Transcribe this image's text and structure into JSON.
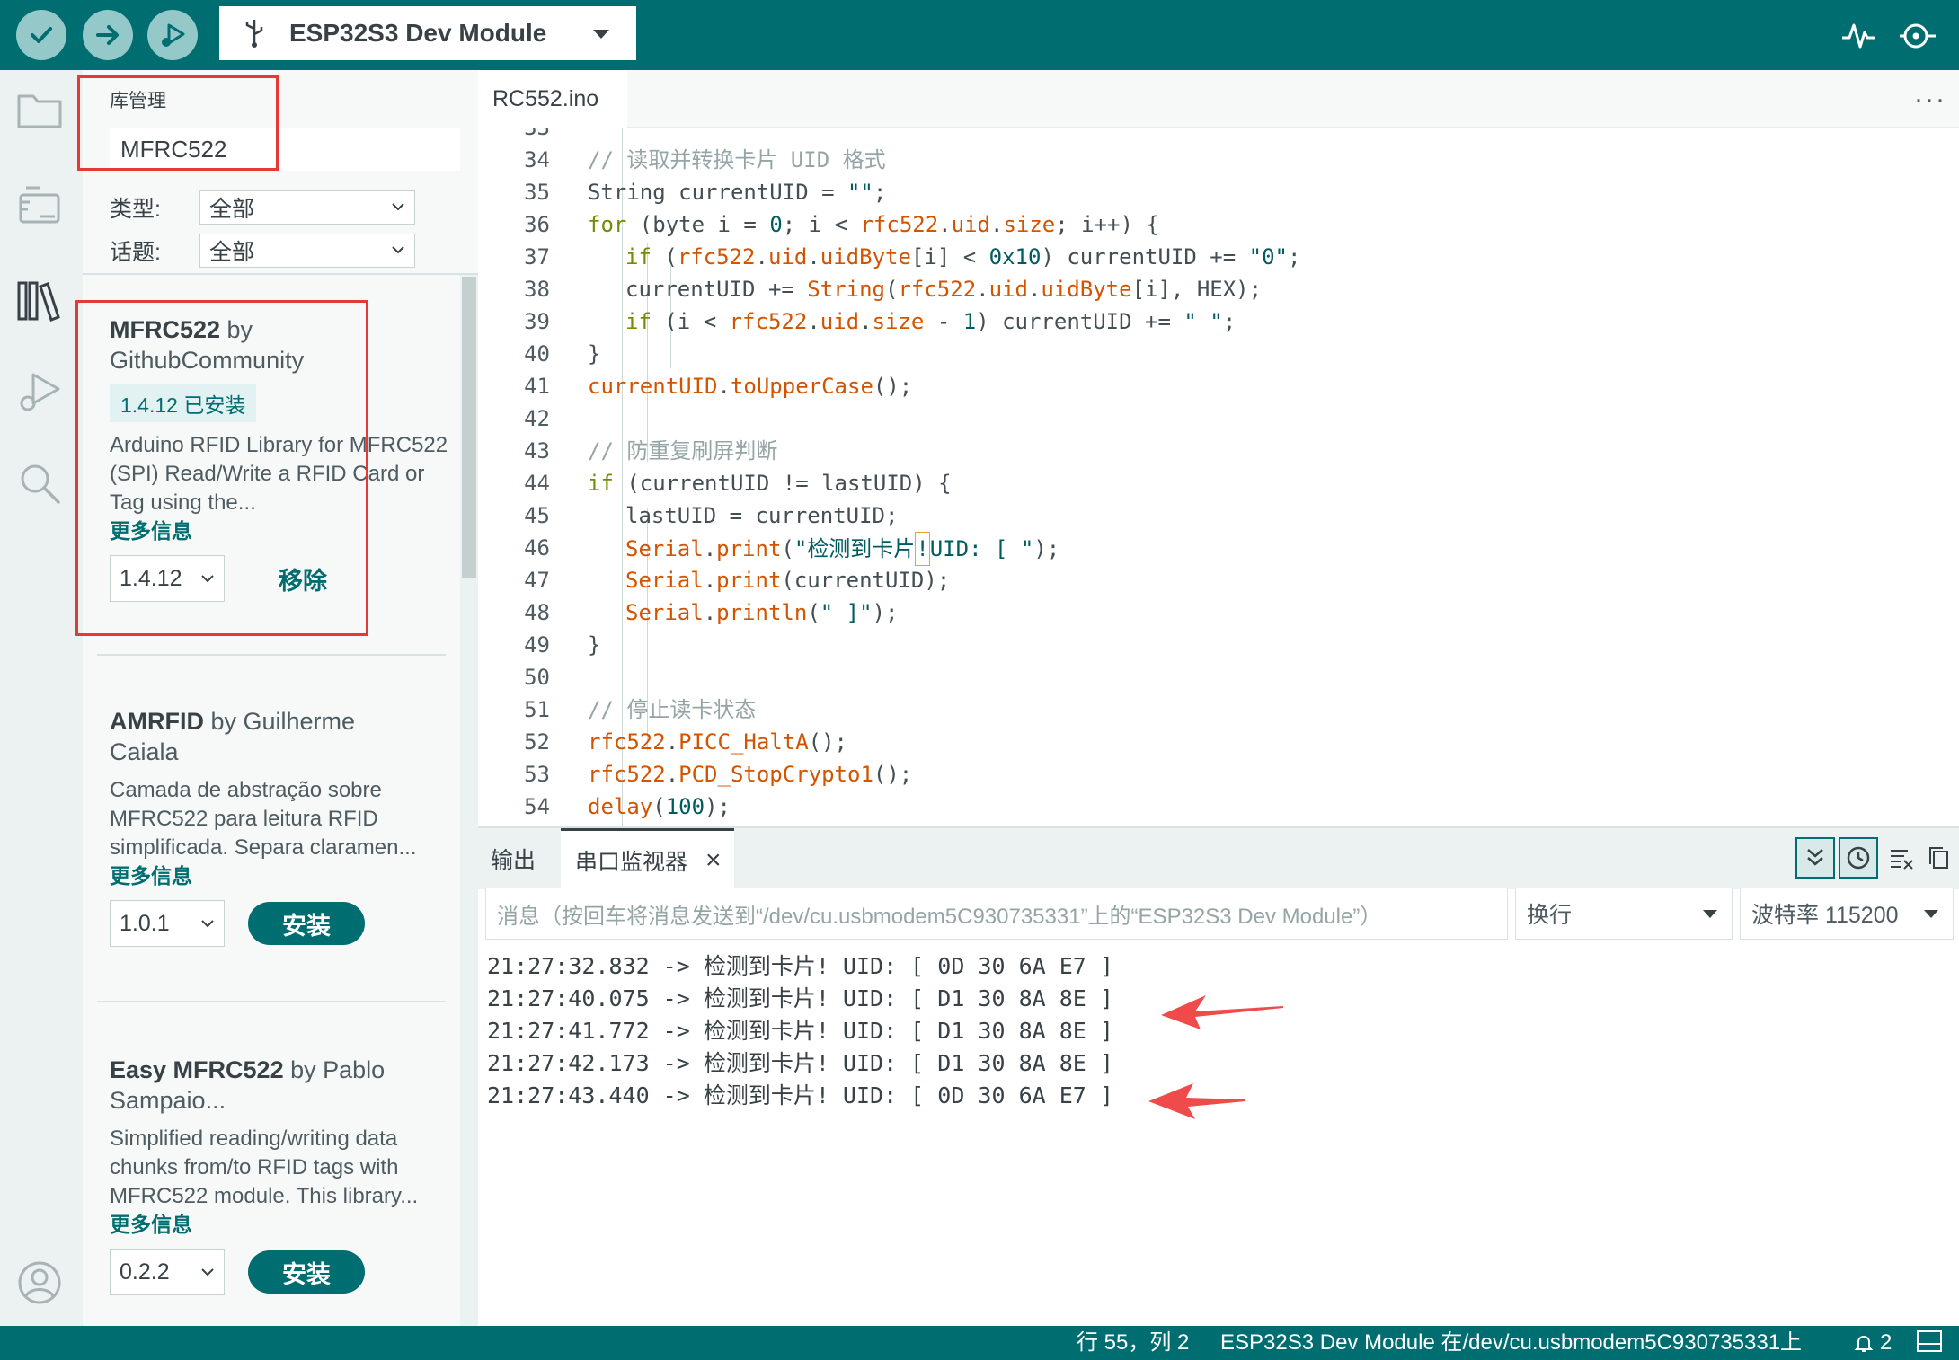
{
  "toolbar": {
    "verify_icon": "check-icon",
    "upload_icon": "arrow-right-icon",
    "debug_icon": "debug-icon",
    "board_name": "ESP32S3 Dev Module",
    "serial_plotter_icon": "pulse-icon",
    "serial_monitor_icon": "magnifier-icon"
  },
  "sidebar": {
    "icons": [
      "folder-icon",
      "board-icon",
      "library-icon",
      "debug-icon",
      "search-icon",
      "account-icon"
    ]
  },
  "library_manager": {
    "title": "库管理",
    "search_value": "MFRC522",
    "type_label": "类型:",
    "type_value": "全部",
    "topic_label": "话题:",
    "topic_value": "全部",
    "items": [
      {
        "name": "MFRC522",
        "by": " by",
        "author": "GithubCommunity",
        "installed_badge": "1.4.12 已安装",
        "desc": "Arduino RFID Library for MFRC522 (SPI) Read/Write a RFID Card or Tag using the...",
        "more": "更多信息",
        "version": "1.4.12",
        "action": "移除"
      },
      {
        "name": "AMRFID",
        "by": " by Guilherme",
        "author": "Caiala",
        "desc": "Camada de abstração sobre MFRC522 para leitura RFID simplificada. Separa claramen...",
        "more": "更多信息",
        "version": "1.0.1",
        "action": "安装"
      },
      {
        "name": "Easy MFRC522",
        "by": " by Pablo",
        "author": "Sampaio...",
        "desc": "Simplified reading/writing data chunks from/to RFID tags with MFRC522 module. This library...",
        "more": "更多信息",
        "version": "0.2.2",
        "action": "安装"
      }
    ]
  },
  "editor": {
    "file_tab": "RC552.ino",
    "more": "···",
    "lines": [
      {
        "n": "33",
        "indent": 0,
        "tokens": []
      },
      {
        "n": "34",
        "indent": 1,
        "tokens": [
          [
            "com",
            "// 读取并转换卡片 UID 格式"
          ]
        ]
      },
      {
        "n": "35",
        "indent": 1,
        "tokens": [
          [
            "def",
            "String currentUID = "
          ],
          [
            "str",
            "\"\""
          ],
          [
            "def",
            ";"
          ]
        ]
      },
      {
        "n": "36",
        "indent": 1,
        "tokens": [
          [
            "kw",
            "for"
          ],
          [
            "def",
            " (byte i = "
          ],
          [
            "num",
            "0"
          ],
          [
            "def",
            "; i < "
          ],
          [
            "fn",
            "rfc522"
          ],
          [
            "def",
            "."
          ],
          [
            "fn",
            "uid"
          ],
          [
            "def",
            "."
          ],
          [
            "fn",
            "size"
          ],
          [
            "def",
            "; i++) {"
          ]
        ]
      },
      {
        "n": "37",
        "indent": 2,
        "tokens": [
          [
            "kw",
            "if"
          ],
          [
            "def",
            " ("
          ],
          [
            "fn",
            "rfc522"
          ],
          [
            "def",
            "."
          ],
          [
            "fn",
            "uid"
          ],
          [
            "def",
            "."
          ],
          [
            "fn",
            "uidByte"
          ],
          [
            "def",
            "[i] < "
          ],
          [
            "num",
            "0x10"
          ],
          [
            "def",
            ") currentUID += "
          ],
          [
            "str",
            "\"0\""
          ],
          [
            "def",
            ";"
          ]
        ]
      },
      {
        "n": "38",
        "indent": 2,
        "tokens": [
          [
            "def",
            "currentUID += "
          ],
          [
            "fn",
            "String"
          ],
          [
            "def",
            "("
          ],
          [
            "fn",
            "rfc522"
          ],
          [
            "def",
            "."
          ],
          [
            "fn",
            "uid"
          ],
          [
            "def",
            "."
          ],
          [
            "fn",
            "uidByte"
          ],
          [
            "def",
            "[i], HEX);"
          ]
        ]
      },
      {
        "n": "39",
        "indent": 2,
        "tokens": [
          [
            "kw",
            "if"
          ],
          [
            "def",
            " (i < "
          ],
          [
            "fn",
            "rfc522"
          ],
          [
            "def",
            "."
          ],
          [
            "fn",
            "uid"
          ],
          [
            "def",
            "."
          ],
          [
            "fn",
            "size"
          ],
          [
            "def",
            " - "
          ],
          [
            "num",
            "1"
          ],
          [
            "def",
            ") currentUID += "
          ],
          [
            "str",
            "\" \""
          ],
          [
            "def",
            ";"
          ]
        ]
      },
      {
        "n": "40",
        "indent": 1,
        "tokens": [
          [
            "def",
            "}"
          ]
        ]
      },
      {
        "n": "41",
        "indent": 1,
        "tokens": [
          [
            "fn",
            "currentUID"
          ],
          [
            "def",
            "."
          ],
          [
            "fn",
            "toUpperCase"
          ],
          [
            "def",
            "();"
          ]
        ]
      },
      {
        "n": "42",
        "indent": 1,
        "tokens": []
      },
      {
        "n": "43",
        "indent": 1,
        "tokens": [
          [
            "com",
            "// 防重复刷屏判断"
          ]
        ]
      },
      {
        "n": "44",
        "indent": 1,
        "tokens": [
          [
            "kw",
            "if"
          ],
          [
            "def",
            " (currentUID != lastUID) {"
          ]
        ]
      },
      {
        "n": "45",
        "indent": 2,
        "tokens": [
          [
            "def",
            "lastUID = currentUID;"
          ]
        ]
      },
      {
        "n": "46",
        "indent": 2,
        "tokens": [
          [
            "fn",
            "Serial"
          ],
          [
            "def",
            "."
          ],
          [
            "fn",
            "print"
          ],
          [
            "def",
            "("
          ],
          [
            "str",
            "\"检测到卡片"
          ],
          [
            "cur",
            "!"
          ],
          [
            "str",
            "UID: [ \""
          ],
          [
            "def",
            ");"
          ]
        ]
      },
      {
        "n": "47",
        "indent": 2,
        "tokens": [
          [
            "fn",
            "Serial"
          ],
          [
            "def",
            "."
          ],
          [
            "fn",
            "print"
          ],
          [
            "def",
            "(currentUID);"
          ]
        ]
      },
      {
        "n": "48",
        "indent": 2,
        "tokens": [
          [
            "fn",
            "Serial"
          ],
          [
            "def",
            "."
          ],
          [
            "fn",
            "println"
          ],
          [
            "def",
            "("
          ],
          [
            "str",
            "\" ]\""
          ],
          [
            "def",
            ");"
          ]
        ]
      },
      {
        "n": "49",
        "indent": 1,
        "tokens": [
          [
            "def",
            "}"
          ]
        ]
      },
      {
        "n": "50",
        "indent": 1,
        "tokens": []
      },
      {
        "n": "51",
        "indent": 1,
        "tokens": [
          [
            "com",
            "// 停止读卡状态"
          ]
        ]
      },
      {
        "n": "52",
        "indent": 1,
        "tokens": [
          [
            "fn",
            "rfc522"
          ],
          [
            "def",
            "."
          ],
          [
            "fn",
            "PICC_HaltA"
          ],
          [
            "def",
            "();"
          ]
        ]
      },
      {
        "n": "53",
        "indent": 1,
        "tokens": [
          [
            "fn",
            "rfc522"
          ],
          [
            "def",
            "."
          ],
          [
            "fn",
            "PCD_StopCrypto1"
          ],
          [
            "def",
            "();"
          ]
        ]
      },
      {
        "n": "54",
        "indent": 1,
        "tokens": [
          [
            "fn",
            "delay"
          ],
          [
            "def",
            "("
          ],
          [
            "num",
            "100"
          ],
          [
            "def",
            ");"
          ]
        ]
      }
    ]
  },
  "bottom_panel": {
    "tab_output": "输出",
    "tab_serial": "串口监视器",
    "close": "×",
    "message_placeholder": "消息（按回车将消息发送到“/dev/cu.usbmodem5C930735331”上的“ESP32S3 Dev Module”）",
    "line_ending": "换行",
    "baud": "波特率 115200",
    "tool_icons": [
      "autoscroll-icon",
      "timestamp-icon",
      "clear-output-icon",
      "copy-icon"
    ],
    "serial_lines": [
      "21:27:32.832 -> 检测到卡片! UID: [ 0D 30 6A E7 ]",
      "21:27:40.075 -> 检测到卡片! UID: [ D1 30 8A 8E ]",
      "21:27:41.772 -> 检测到卡片! UID: [ D1 30 8A 8E ]",
      "21:27:42.173 -> 检测到卡片! UID: [ D1 30 8A 8E ]",
      "21:27:43.440 -> 检测到卡片! UID: [ 0D 30 6A E7 ]"
    ]
  },
  "statusbar": {
    "cursor_pos": "行 55，列 2",
    "board_port": "ESP32S3 Dev Module 在/dev/cu.usbmodem5C930735331上",
    "notifications": "2",
    "notification_icon": "bell-icon",
    "panel_icon": "panel-toggle-icon"
  },
  "colors": {
    "brand": "#006d70",
    "annotation_red": "#e53935"
  }
}
